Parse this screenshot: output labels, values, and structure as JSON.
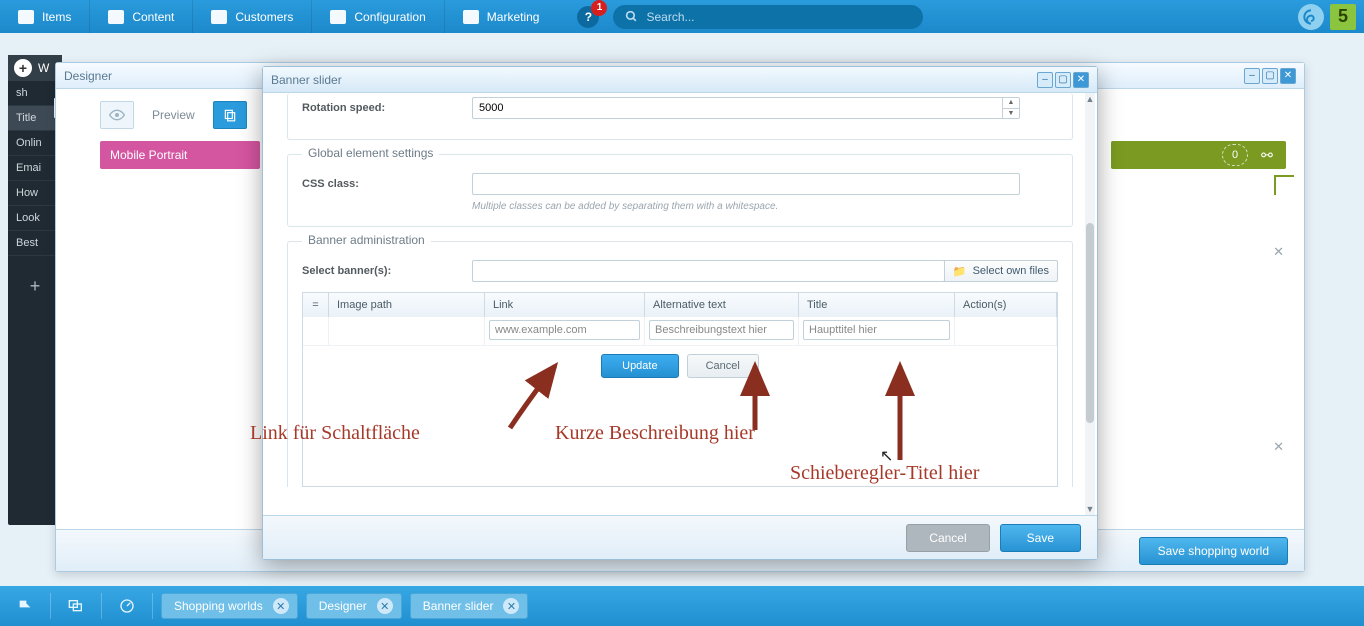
{
  "topbar": {
    "items": [
      "Items",
      "Content",
      "Customers",
      "Configuration",
      "Marketing"
    ],
    "help_badge": "1",
    "search_placeholder": "Search..."
  },
  "sidebar": {
    "header_letter": "W",
    "rows": [
      "sh",
      "Title",
      "Onlin",
      "Emai",
      "How",
      "Look",
      "Best"
    ]
  },
  "designer": {
    "title": "Designer",
    "preview_label": "Preview",
    "mobile_chip": "Mobile Portrait",
    "zero_badge": "0",
    "save_btn": "Save shopping world"
  },
  "modal": {
    "title": "Banner slider",
    "rotation_label": "Rotation speed:",
    "rotation_value": "5000",
    "global_legend": "Global element settings",
    "css_label": "CSS class:",
    "css_hint": "Multiple classes can be added by separating them with a whitespace.",
    "banner_legend": "Banner administration",
    "select_label": "Select banner(s):",
    "select_files_btn": "Select own files",
    "cols": {
      "handle": "=",
      "img": "Image path",
      "link": "Link",
      "alt": "Alternative text",
      "title": "Title",
      "act": "Action(s)"
    },
    "row": {
      "link_val": "www.example.com",
      "alt_val": "Beschreibungstext hier",
      "title_val": "Haupttitel hier"
    },
    "update_btn": "Update",
    "cancel_btn": "Cancel",
    "footer_cancel": "Cancel",
    "footer_save": "Save"
  },
  "annotations": {
    "link": "Link für Schaltfläche",
    "desc": "Kurze Beschreibung hier",
    "title": "Schieberegler-Titel hier"
  },
  "taskbar": {
    "pills": [
      "Shopping worlds",
      "Designer",
      "Banner slider"
    ]
  }
}
